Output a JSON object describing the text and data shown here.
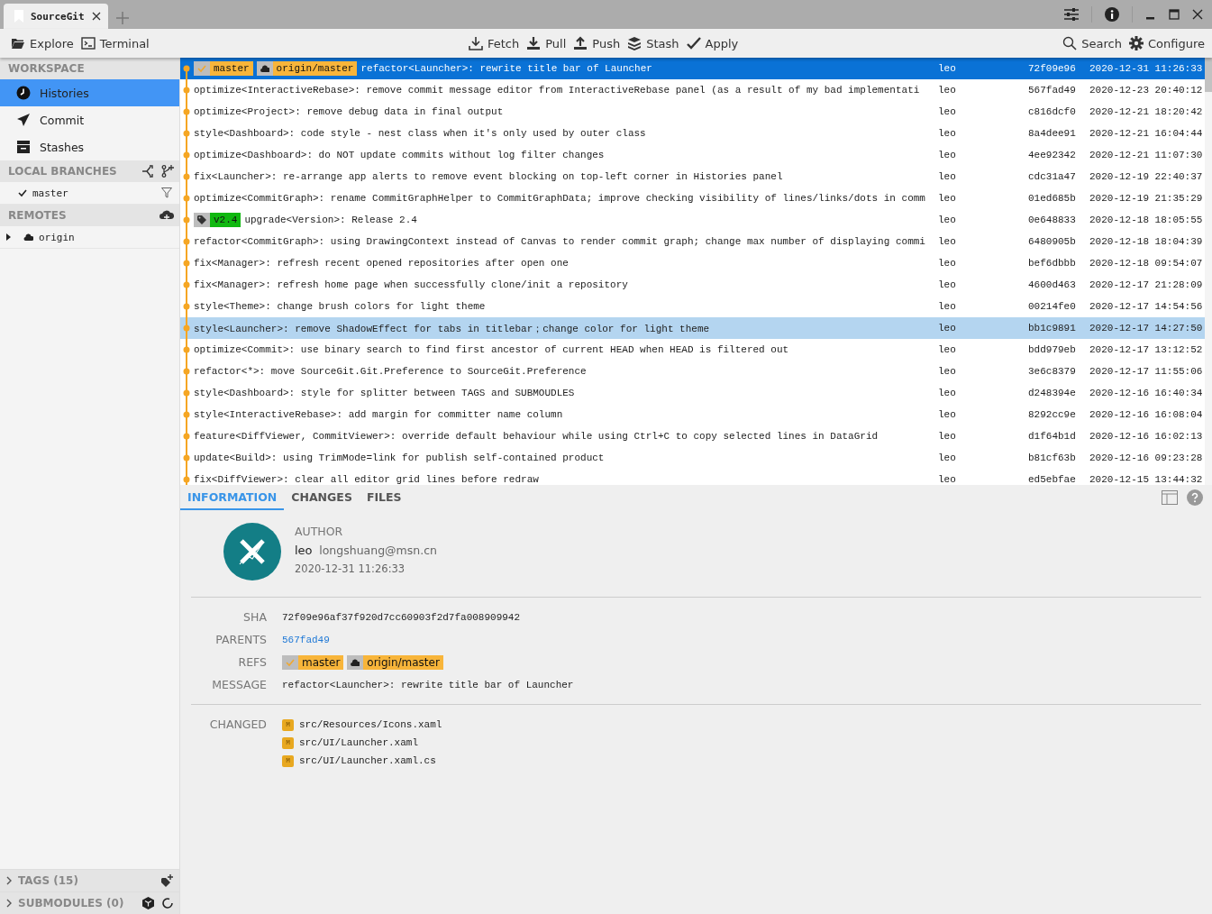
{
  "window": {
    "tab_title": "SourceGit"
  },
  "toolbar": {
    "left": [
      {
        "kind": "folder",
        "label": "Explore"
      },
      {
        "kind": "terminal",
        "label": "Terminal"
      }
    ],
    "center": [
      {
        "kind": "fetch",
        "label": "Fetch"
      },
      {
        "kind": "pull",
        "label": "Pull"
      },
      {
        "kind": "push",
        "label": "Push"
      },
      {
        "kind": "stash",
        "label": "Stash"
      },
      {
        "kind": "apply",
        "label": "Apply"
      }
    ],
    "right": [
      {
        "kind": "search",
        "label": "Search"
      },
      {
        "kind": "gear",
        "label": "Configure"
      }
    ]
  },
  "sidebar": {
    "workspace": {
      "title": "WORKSPACE",
      "items": [
        {
          "kind": "clock",
          "label": "Histories",
          "selected": true
        },
        {
          "kind": "send",
          "label": "Commit",
          "selected": false
        },
        {
          "kind": "box",
          "label": "Stashes",
          "selected": false
        }
      ]
    },
    "local_branches": {
      "title": "LOCAL BRANCHES",
      "items": [
        {
          "label": "master",
          "current": true
        }
      ]
    },
    "remotes": {
      "title": "REMOTES",
      "items": [
        {
          "label": "origin",
          "expanded": false
        }
      ]
    },
    "tags": {
      "title": "TAGS (15)",
      "expanded": false
    },
    "submodules": {
      "title": "SUBMODULES (0)",
      "expanded": false
    }
  },
  "commits": [
    {
      "refs": [
        {
          "kind": "branch",
          "name": "master"
        },
        {
          "kind": "remote",
          "name": "origin/master"
        }
      ],
      "message": "refactor<Launcher>: rewrite title bar of Launcher",
      "author": "leo",
      "sha": "72f09e96",
      "time": "2020-12-31 11:26:33",
      "selected": true,
      "hovered": false
    },
    {
      "message": "optimize<InteractiveRebase>: remove commit message editor from InteractiveRebase panel (as a result of my bad implementati",
      "author": "leo",
      "sha": "567fad49",
      "time": "2020-12-23 20:40:12",
      "selected": false,
      "hovered": false
    },
    {
      "message": "optimize<Project>: remove debug data in final output",
      "author": "leo",
      "sha": "c816dcf0",
      "time": "2020-12-21 18:20:42",
      "selected": false,
      "hovered": false
    },
    {
      "message": "style<Dashboard>: code style - nest class when it's only used by outer class",
      "author": "leo",
      "sha": "8a4dee91",
      "time": "2020-12-21 16:04:44",
      "selected": false,
      "hovered": false
    },
    {
      "message": "optimize<Dashboard>: do NOT update commits without log filter changes",
      "author": "leo",
      "sha": "4ee92342",
      "time": "2020-12-21 11:07:30",
      "selected": false,
      "hovered": false
    },
    {
      "message": "fix<Launcher>: re-arrange app alerts to remove event blocking on top-left corner in Histories panel",
      "author": "leo",
      "sha": "cdc31a47",
      "time": "2020-12-19 22:40:37",
      "selected": false,
      "hovered": false
    },
    {
      "message": "optimize<CommitGraph>: rename CommitGraphHelper to CommitGraphData; improve checking visibility of lines/links/dots in comm",
      "author": "leo",
      "sha": "01ed685b",
      "time": "2020-12-19 21:35:29",
      "selected": false,
      "hovered": false
    },
    {
      "refs": [
        {
          "kind": "tag",
          "name": "v2.4"
        }
      ],
      "message": "upgrade<Version>: Release 2.4",
      "author": "leo",
      "sha": "0e648833",
      "time": "2020-12-18 18:05:55",
      "selected": false,
      "hovered": false
    },
    {
      "message": "refactor<CommitGraph>: using DrawingContext instead of Canvas to render commit graph; change max number of displaying commi",
      "author": "leo",
      "sha": "6480905b",
      "time": "2020-12-18 18:04:39",
      "selected": false,
      "hovered": false
    },
    {
      "message": "fix<Manager>: refresh recent opened repositories after open one",
      "author": "leo",
      "sha": "bef6dbbb",
      "time": "2020-12-18 09:54:07",
      "selected": false,
      "hovered": false
    },
    {
      "message": "fix<Manager>: refresh home page when successfully clone/init a repository",
      "author": "leo",
      "sha": "4600d463",
      "time": "2020-12-17 21:28:09",
      "selected": false,
      "hovered": false
    },
    {
      "message": "style<Theme>: change brush colors for light theme",
      "author": "leo",
      "sha": "00214fe0",
      "time": "2020-12-17 14:54:56",
      "selected": false,
      "hovered": false
    },
    {
      "message": "style<Launcher>: remove ShadowEffect for tabs in titlebar；change color for light theme",
      "author": "leo",
      "sha": "bb1c9891",
      "time": "2020-12-17 14:27:50",
      "selected": false,
      "hovered": true
    },
    {
      "message": "optimize<Commit>: use binary search to find first ancestor of current HEAD when HEAD is filtered out",
      "author": "leo",
      "sha": "bdd979eb",
      "time": "2020-12-17 13:12:52",
      "selected": false,
      "hovered": false
    },
    {
      "message": "refactor<*>: move SourceGit.Git.Preference to SourceGit.Preference",
      "author": "leo",
      "sha": "3e6c8379",
      "time": "2020-12-17 11:55:06",
      "selected": false,
      "hovered": false
    },
    {
      "message": "style<Dashboard>: style for splitter between TAGS and SUBMOUDLES",
      "author": "leo",
      "sha": "d248394e",
      "time": "2020-12-16 16:40:34",
      "selected": false,
      "hovered": false
    },
    {
      "message": "style<InteractiveRebase>: add margin for committer name column",
      "author": "leo",
      "sha": "8292cc9e",
      "time": "2020-12-16 16:08:04",
      "selected": false,
      "hovered": false
    },
    {
      "message": "feature<DiffViewer, CommitViewer>: override default behaviour while using Ctrl+C to copy selected lines in DataGrid",
      "author": "leo",
      "sha": "d1f64b1d",
      "time": "2020-12-16 16:02:13",
      "selected": false,
      "hovered": false
    },
    {
      "message": "update<Build>: using TrimMode=link for publish self-contained product",
      "author": "leo",
      "sha": "b81cf63b",
      "time": "2020-12-16 09:23:28",
      "selected": false,
      "hovered": false
    },
    {
      "message": "fix<DiffViewer>: clear all editor grid lines before redraw",
      "author": "leo",
      "sha": "ed5ebfae",
      "time": "2020-12-15 13:44:32",
      "selected": false,
      "hovered": false
    }
  ],
  "detail": {
    "tabs": [
      {
        "label": "INFORMATION",
        "selected": true
      },
      {
        "label": "CHANGES",
        "selected": false
      },
      {
        "label": "FILES",
        "selected": false
      }
    ],
    "author_label": "AUTHOR",
    "author_name": "leo",
    "author_email": "longshuang@msn.cn",
    "author_time": "2020-12-31 11:26:33",
    "fields": [
      {
        "kind": "text",
        "label": "SHA",
        "value": "72f09e96af37f920d7cc60903f2d7fa008909942"
      },
      {
        "kind": "link",
        "label": "PARENTS",
        "value": "567fad49"
      },
      {
        "kind": "refs",
        "label": "REFS",
        "refs": [
          {
            "kind": "branch",
            "name": "master"
          },
          {
            "kind": "remote",
            "name": "origin/master"
          }
        ]
      },
      {
        "kind": "text",
        "label": "MESSAGE",
        "value": "refactor<Launcher>: rewrite title bar of Launcher"
      }
    ],
    "changed_label": "CHANGED",
    "changed": [
      {
        "status": "M",
        "path": "src/Resources/Icons.xaml"
      },
      {
        "status": "M",
        "path": "src/UI/Launcher.xaml"
      },
      {
        "status": "M",
        "path": "src/UI/Launcher.xaml.cs"
      }
    ]
  }
}
